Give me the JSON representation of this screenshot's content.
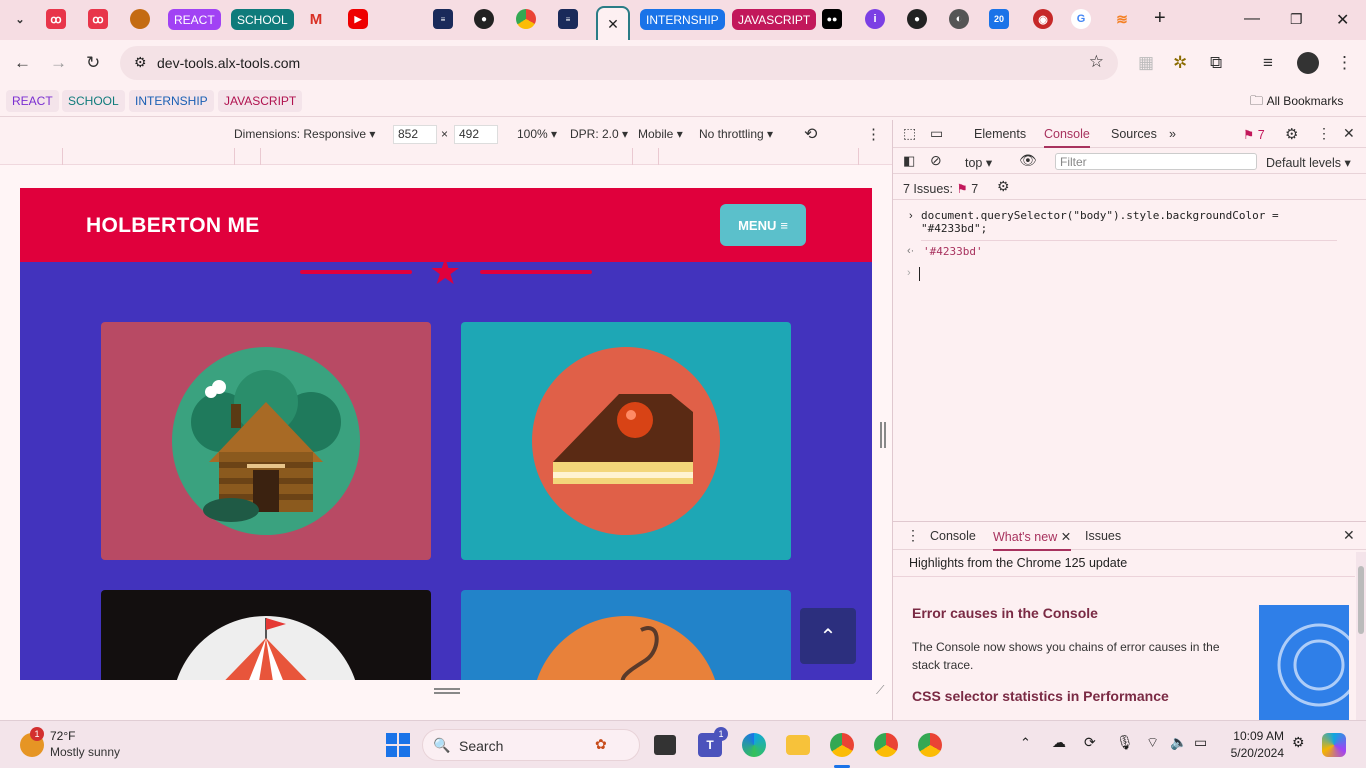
{
  "tabs": {
    "pills": [
      {
        "label": "REACT",
        "color": "#a142f4"
      },
      {
        "label": "SCHOOL",
        "color": "#0f7b7b"
      },
      {
        "label": "INTERNSHIP",
        "color": "#1a73e8"
      },
      {
        "label": "JAVASCRIPT",
        "color": "#c2185b"
      }
    ],
    "active_close": "✕",
    "new_tab": "+"
  },
  "toolbar": {
    "url": "dev-tools.alx-tools.com"
  },
  "bookmarks": {
    "items": [
      "REACT",
      "SCHOOL",
      "INTERNSHIP",
      "JAVASCRIPT"
    ],
    "all_bookmarks": "All Bookmarks"
  },
  "device_bar": {
    "dimensions": "Dimensions: Responsive",
    "width": "852",
    "height": "492",
    "times": "×",
    "zoom": "100%",
    "dpr": "DPR: 2.0",
    "mode": "Mobile",
    "throttling": "No throttling"
  },
  "site": {
    "title": "HOLBERTON ME",
    "menu": "MENU",
    "bg_color": "#4233bd",
    "header_color": "#e0003c"
  },
  "devtools": {
    "tabs": [
      "Elements",
      "Console",
      "Sources"
    ],
    "issue_count": "7",
    "context": "top",
    "filter_placeholder": "Filter",
    "levels": "Default levels",
    "issues_label": "7 Issues:",
    "issues_count": "7",
    "command_line1": "document.querySelector(\"body\").style.backgroundColor =",
    "command_line2": "\"#4233bd\";",
    "result": "'#4233bd'",
    "drawer": {
      "tabs": [
        "Console",
        "What's new",
        "Issues"
      ],
      "headline": "Highlights from the Chrome 125 update",
      "section1_title": "Error causes in the Console",
      "section1_body": "The Console now shows you chains of error causes in the stack trace.",
      "section2_title": "CSS selector statistics in Performance"
    }
  },
  "taskbar": {
    "weather_temp": "72°F",
    "weather_desc": "Mostly sunny",
    "weather_badge": "1",
    "search": "Search",
    "teams_badge": "1",
    "time": "10:09 AM",
    "date": "5/20/2024"
  }
}
